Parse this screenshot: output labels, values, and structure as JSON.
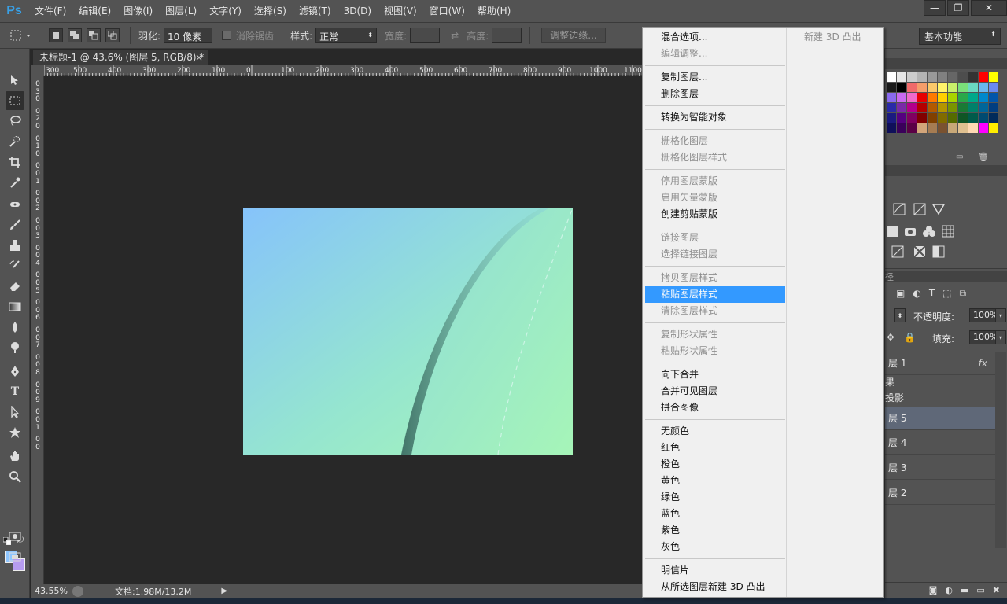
{
  "app": {
    "logo_text": "Ps"
  },
  "menubar": {
    "items": [
      "文件(F)",
      "编辑(E)",
      "图像(I)",
      "图层(L)",
      "文字(Y)",
      "选择(S)",
      "滤镜(T)",
      "3D(D)",
      "视图(V)",
      "窗口(W)",
      "帮助(H)"
    ]
  },
  "window_controls": {
    "minimize": "—",
    "restore": "❐",
    "close": "✕"
  },
  "options_bar": {
    "feather_label": "羽化:",
    "feather_value": "10 像素",
    "antialias_label": "消除锯齿",
    "style_label": "样式:",
    "style_value": "正常",
    "width_label": "宽度:",
    "height_label": "高度:",
    "refine_edge_button": "调整边缘...",
    "workspace_value": "基本功能"
  },
  "document": {
    "tab_title": "未标题-1 @ 43.6% (图层 5, RGB/8) *",
    "tab_close": "×"
  },
  "rulers": {
    "horizontal_labels": [
      "300",
      "500",
      "400",
      "300",
      "200",
      "100",
      "0",
      "100",
      "200",
      "300",
      "400",
      "500",
      "600",
      "700",
      "800",
      "900",
      "1000",
      "1100"
    ],
    "vertical_labels": [
      "0",
      "3",
      "0",
      "0",
      "2",
      "0",
      "0",
      "1",
      "0",
      "0",
      "0",
      "1",
      "0",
      "0",
      "2",
      "0",
      "0",
      "3",
      "0",
      "0",
      "4",
      "0",
      "0",
      "5",
      "0",
      "0",
      "6",
      "0",
      "0",
      "7",
      "0",
      "0",
      "8",
      "0",
      "0",
      "9",
      "0",
      "0",
      "1",
      "0",
      "0"
    ]
  },
  "status_bar": {
    "zoom": "43.55%",
    "doc_info": "文档:1.98M/13.2M"
  },
  "context_menu": {
    "items": [
      {
        "label": "混合选项...",
        "state": "enabled"
      },
      {
        "label": "编辑调整...",
        "state": "disabled"
      },
      {
        "label": "复制图层...",
        "state": "enabled"
      },
      {
        "label": "删除图层",
        "state": "enabled"
      },
      {
        "label": "转换为智能对象",
        "state": "enabled"
      },
      {
        "label": "栅格化图层",
        "state": "disabled"
      },
      {
        "label": "栅格化图层样式",
        "state": "disabled"
      },
      {
        "label": "停用图层蒙版",
        "state": "disabled"
      },
      {
        "label": "启用矢量蒙版",
        "state": "disabled"
      },
      {
        "label": "创建剪贴蒙版",
        "state": "enabled"
      },
      {
        "label": "链接图层",
        "state": "disabled"
      },
      {
        "label": "选择链接图层",
        "state": "disabled"
      },
      {
        "label": "拷贝图层样式",
        "state": "disabled"
      },
      {
        "label": "粘贴图层样式",
        "state": "highlighted"
      },
      {
        "label": "清除图层样式",
        "state": "disabled"
      },
      {
        "label": "复制形状属性",
        "state": "disabled"
      },
      {
        "label": "粘贴形状属性",
        "state": "disabled"
      },
      {
        "label": "向下合并",
        "state": "enabled"
      },
      {
        "label": "合并可见图层",
        "state": "enabled"
      },
      {
        "label": "拼合图像",
        "state": "enabled"
      },
      {
        "label": "无颜色",
        "state": "enabled"
      },
      {
        "label": "红色",
        "state": "enabled"
      },
      {
        "label": "橙色",
        "state": "enabled"
      },
      {
        "label": "黄色",
        "state": "enabled"
      },
      {
        "label": "绿色",
        "state": "enabled"
      },
      {
        "label": "蓝色",
        "state": "enabled"
      },
      {
        "label": "紫色",
        "state": "enabled"
      },
      {
        "label": "灰色",
        "state": "enabled"
      },
      {
        "label": "明信片",
        "state": "enabled"
      },
      {
        "label": "从所选图层新建 3D 凸出",
        "state": "enabled"
      }
    ],
    "right_column_item": "新建 3D 凸出"
  },
  "layers_panel": {
    "paths_tab_partial": "径",
    "opacity_label": "不透明度:",
    "opacity_value": "100%",
    "fill_label": "填充:",
    "fill_value": "100%",
    "fx_badge": "fx",
    "layers": [
      {
        "name": "层 1",
        "selected": false
      },
      {
        "name": "果",
        "selected": false
      },
      {
        "name": "投影",
        "selected": false
      },
      {
        "name": "层 5",
        "selected": true
      },
      {
        "name": "层 4",
        "selected": false
      },
      {
        "name": "层 3",
        "selected": false
      },
      {
        "name": "层 2",
        "selected": false
      }
    ]
  },
  "colors": {
    "foreground": "#8fc6ff",
    "background": "#b69cf0",
    "canvas_gradient_start": "#86c3fb",
    "canvas_gradient_end": "#a8f7b6",
    "menu_highlight": "#3399ff"
  },
  "swatches": [
    "#ffffff",
    "#e6e6e6",
    "#cccccc",
    "#b3b3b3",
    "#999999",
    "#808080",
    "#666666",
    "#4d4d4d",
    "#333333",
    "#ff0000",
    "#ffff00",
    "#1a1a1a",
    "#000000",
    "#f06a6a",
    "#f59d6a",
    "#fbc96a",
    "#fff46a",
    "#c9f06a",
    "#7ae07a",
    "#6ad9c2",
    "#6ab8f0",
    "#6a8af0",
    "#8a6af0",
    "#c96af0",
    "#f06ac9",
    "#e60000",
    "#ff7a00",
    "#ffd000",
    "#a8d400",
    "#2aa84a",
    "#00a88a",
    "#0088cc",
    "#0055aa",
    "#2a2aa8",
    "#7a2aa8",
    "#b3008a",
    "#b30000",
    "#b35a00",
    "#b39500",
    "#7a9500",
    "#1a7a35",
    "#00806a",
    "#006699",
    "#003d80",
    "#1a1a80",
    "#550080",
    "#800060",
    "#800000",
    "#804000",
    "#806b00",
    "#556b00",
    "#0f5525",
    "#005a4a",
    "#004a70",
    "#002a5a",
    "#0f0f5a",
    "#3a005a",
    "#5a0045",
    "#d2a57a",
    "#a67c52",
    "#7a5230",
    "#c8a878",
    "#e0c090",
    "#ffd9b3",
    "#ff00ff",
    "#ffee00"
  ]
}
